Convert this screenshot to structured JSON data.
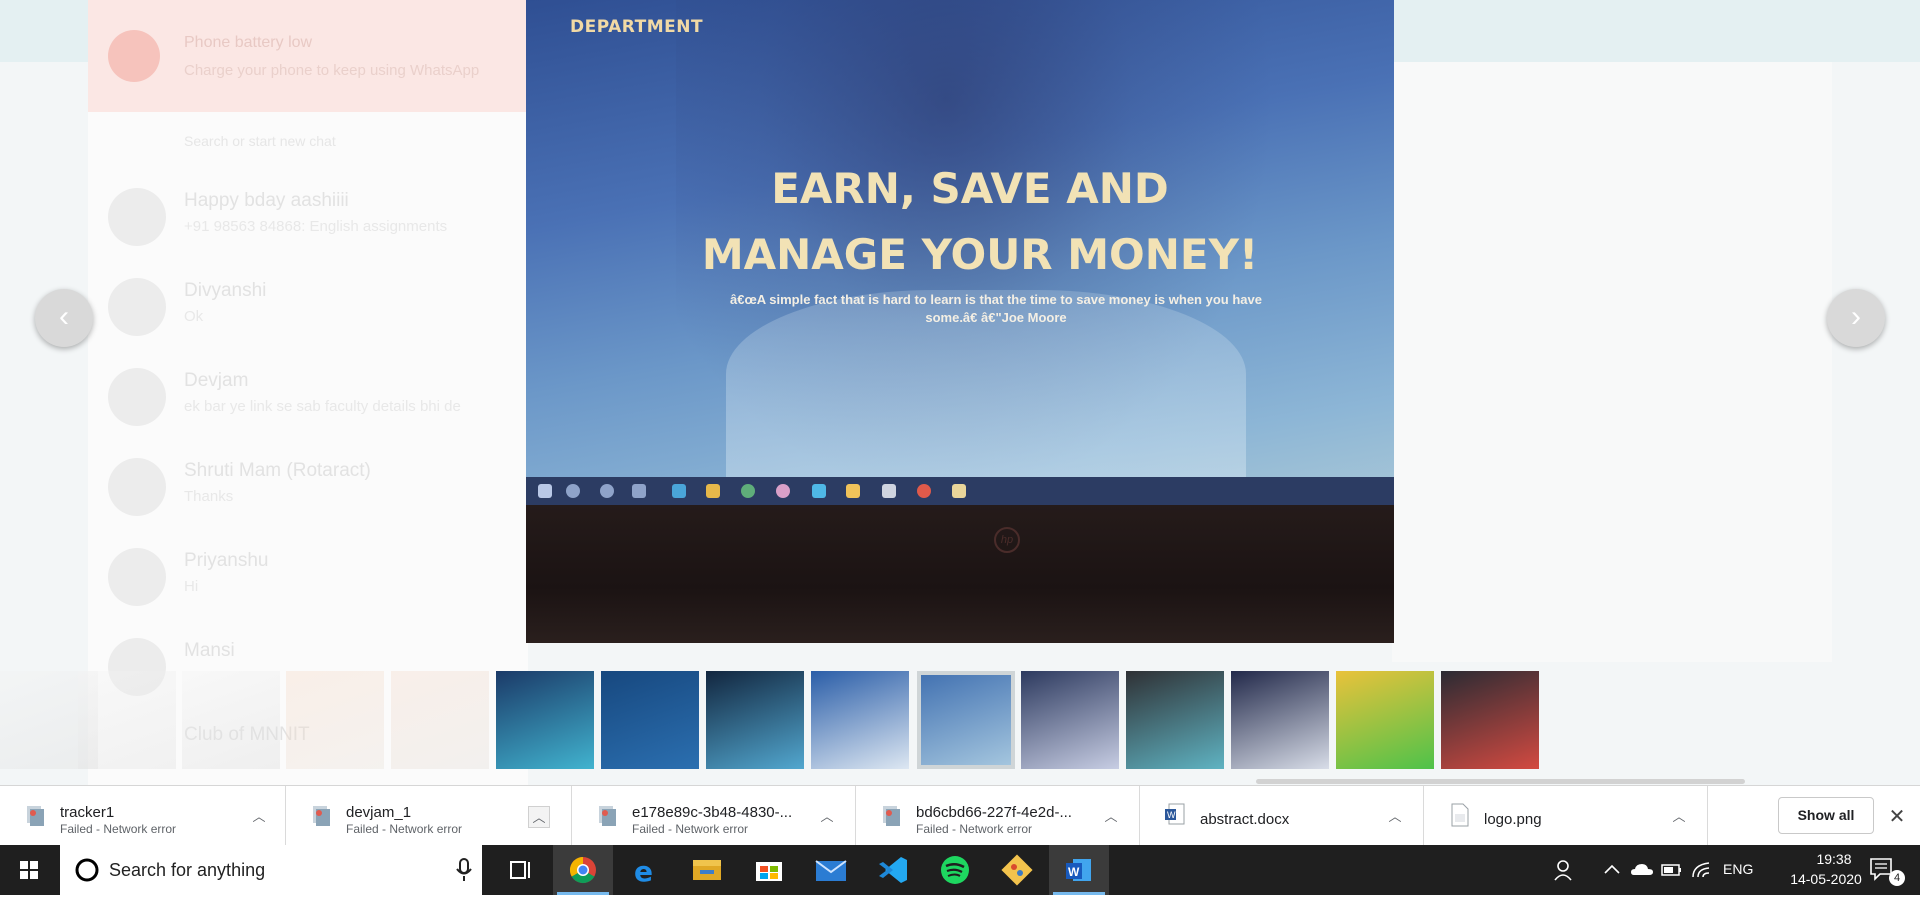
{
  "background_app": {
    "banner_title": "Phone battery low",
    "banner_text": "Charge your phone to keep using WhatsApp",
    "search_placeholder": "Search or start new chat",
    "chats": [
      {
        "name": "Happy bday aashiiii",
        "message": "+91 98563 84868: English assignments"
      },
      {
        "name": "Divyanshi",
        "message": "Ok"
      },
      {
        "name": "Devjam",
        "message": "ek bar ye link se sab faculty details bhi de"
      },
      {
        "name": "Shruti Mam (Rotaract)",
        "message": "Thanks"
      },
      {
        "name": "Priyanshu",
        "message": "Hi"
      },
      {
        "name": "Mansi",
        "message": ""
      },
      {
        "name": "Club of MNNIT",
        "message": ""
      }
    ]
  },
  "viewer": {
    "photo": {
      "department_label": "DEPARTMENT",
      "headline_line1": "EARN, SAVE AND",
      "headline_line2": "MANAGE YOUR MONEY!",
      "quote": "â€œA simple fact that is hard to learn is that the time to save money is when you have some.â€ â€\"Joe Moore"
    },
    "prev_label": "‹",
    "next_label": "›",
    "thumbnails": [
      {
        "name": "thumb-1",
        "faded": true,
        "colors": [
          "#f2f2f2",
          "#dcdcdc"
        ]
      },
      {
        "name": "thumb-2",
        "faded": true,
        "colors": [
          "#f4f4f4",
          "#dedede"
        ]
      },
      {
        "name": "thumb-3",
        "faded": true,
        "colors": [
          "#f3f3f3",
          "#d8d8d8"
        ]
      },
      {
        "name": "thumb-4",
        "faded": true,
        "colors": [
          "#f6d8c4",
          "#e8e0d8"
        ]
      },
      {
        "name": "thumb-5",
        "faded": true,
        "colors": [
          "#f3d8c8",
          "#e2dcd6"
        ]
      },
      {
        "name": "thumb-6",
        "faded": false,
        "colors": [
          "#1b3a68",
          "#41b3cf"
        ]
      },
      {
        "name": "thumb-7",
        "faded": false,
        "colors": [
          "#17487f",
          "#2b6fb0"
        ]
      },
      {
        "name": "thumb-8",
        "faded": false,
        "colors": [
          "#12263f",
          "#52a7cf"
        ]
      },
      {
        "name": "thumb-9",
        "faded": false,
        "colors": [
          "#2b5ea8",
          "#dde7f2"
        ]
      },
      {
        "name": "thumb-10",
        "faded": false,
        "colors": [
          "#3f6fb0",
          "#a8c9e0"
        ]
      },
      {
        "name": "thumb-11",
        "faded": false,
        "colors": [
          "#2d3a5f",
          "#c7cde3"
        ]
      },
      {
        "name": "thumb-12",
        "faded": false,
        "colors": [
          "#2f3135",
          "#5fb3c2"
        ]
      },
      {
        "name": "thumb-13",
        "faded": false,
        "colors": [
          "#22294a",
          "#d8dde8"
        ]
      },
      {
        "name": "thumb-14",
        "faded": false,
        "colors": [
          "#e9c23b",
          "#4ec24a"
        ]
      },
      {
        "name": "thumb-15",
        "faded": false,
        "colors": [
          "#2b2b33",
          "#d34a41"
        ]
      }
    ]
  },
  "downloads": {
    "items": [
      {
        "name": "tracker1",
        "status": "Failed - Network error",
        "icon": "file-failed-icon"
      },
      {
        "name": "devjam_1",
        "status": "Failed - Network error",
        "icon": "file-failed-icon"
      },
      {
        "name": "e178e89c-3b48-4830-...",
        "status": "Failed - Network error",
        "icon": "file-failed-icon"
      },
      {
        "name": "bd6cbd66-227f-4e2d-...",
        "status": "Failed - Network error",
        "icon": "file-failed-icon"
      },
      {
        "name": "abstract.docx",
        "status": "",
        "icon": "word-file-icon"
      },
      {
        "name": "logo.png",
        "status": "",
        "icon": "image-file-icon"
      }
    ],
    "show_all_label": "Show all",
    "close_label": "✕"
  },
  "taskbar": {
    "search_placeholder": "Search for anything",
    "apps": [
      "chrome-icon",
      "edge-icon",
      "file-explorer-icon",
      "store-icon",
      "mail-icon",
      "vscode-icon",
      "spotify-icon",
      "git-icon",
      "word-icon"
    ],
    "language": "ENG",
    "time": "19:38",
    "date": "14-05-2020",
    "notification_count": "4",
    "colors": {
      "taskbar": "#1f1f1f",
      "active_underline": "#76b9ed"
    }
  }
}
